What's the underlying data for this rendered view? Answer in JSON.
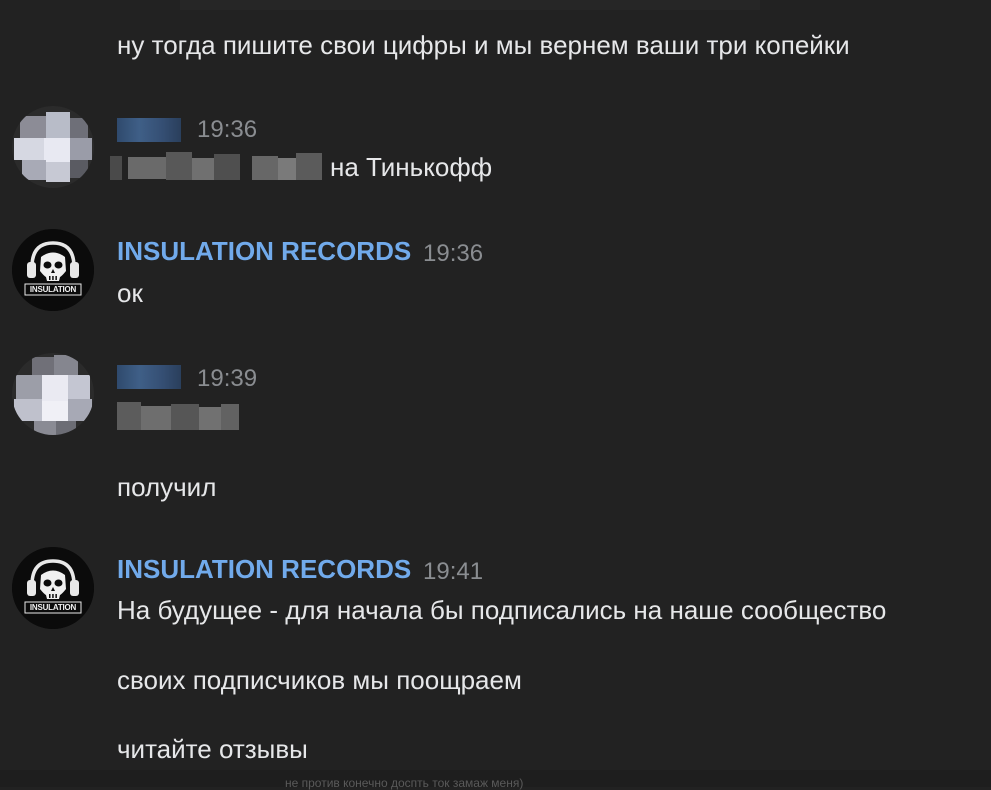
{
  "messages": [
    {
      "text": "ну тогда пишите свои цифры и мы вернем ваши три копейки"
    },
    {
      "author": "",
      "time": "19:36",
      "text": "на Тинькофф"
    },
    {
      "author": "INSULATION RECORDS",
      "time": "19:36",
      "text": "ок",
      "avatar_label": "INSULATION"
    },
    {
      "author": "",
      "time": "19:39",
      "text_extra": "получил"
    },
    {
      "author": "INSULATION RECORDS",
      "time": "19:41",
      "avatar_label": "INSULATION",
      "lines": [
        "На будущее - для начала бы подписались на наше сообщество",
        "своих подписчиков мы поощраем",
        "читайте отзывы"
      ]
    }
  ],
  "footer_partial": "не против конечно доспть ток замаж меня)",
  "colors": {
    "background": "#222222",
    "author": "#71aaeb",
    "text": "#e6e7e9",
    "time": "#8a8d91"
  },
  "icons": {
    "insulation_avatar": "skull-headphones-logo"
  }
}
